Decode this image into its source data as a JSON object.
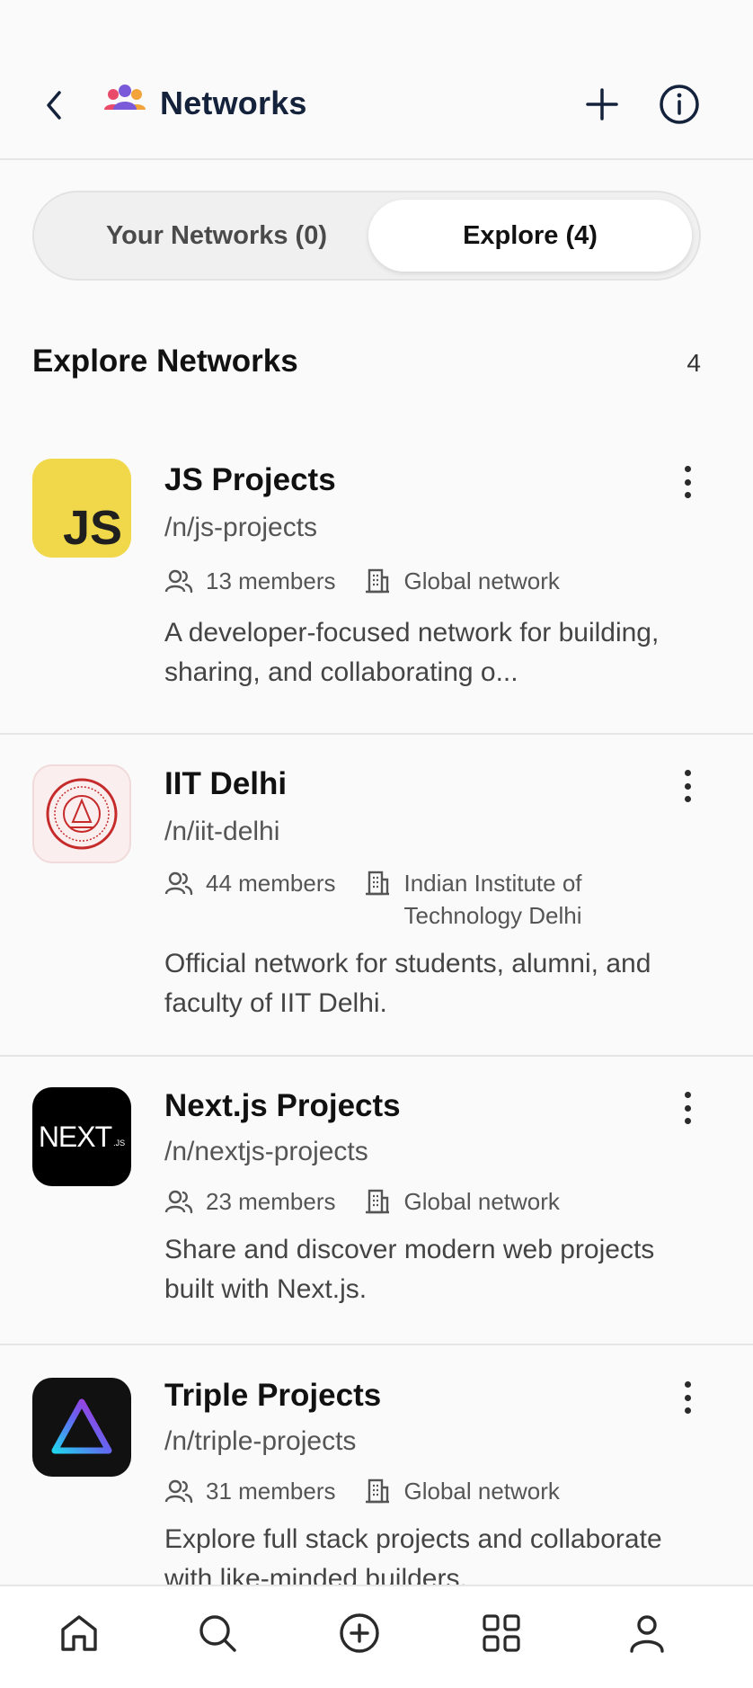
{
  "header": {
    "title": "Networks"
  },
  "tabs": [
    {
      "label": "Your Networks (0)",
      "active": false
    },
    {
      "label": "Explore (4)",
      "active": true
    }
  ],
  "section": {
    "title": "Explore Networks",
    "count": "4"
  },
  "networks": [
    {
      "name": "JS Projects",
      "slug": "/n/js-projects",
      "members": "13 members",
      "scope": "Global network",
      "description": "A developer-focused network for building, sharing, and collaborating o...",
      "logo_text": "JS",
      "logo_color": "#f0d84a"
    },
    {
      "name": "IIT Delhi",
      "slug": "/n/iit-delhi",
      "members": "44 members",
      "scope": "Indian Institute of Technology Delhi",
      "description": "Official network for students, alumni, and faculty of IIT Delhi.",
      "logo_color": "#c62b2b"
    },
    {
      "name": "Next.js Projects",
      "slug": "/n/nextjs-projects",
      "members": "23 members",
      "scope": "Global network",
      "description": "Share and discover modern web projects built with Next.js.",
      "logo_text": "NEXT",
      "logo_subtext": ".JS",
      "logo_color": "#000000"
    },
    {
      "name": "Triple Projects",
      "slug": "/n/triple-projects",
      "members": "31 members",
      "scope": "Global network",
      "description": "Explore full stack projects and collaborate with like-minded builders.",
      "logo_color": "#111111"
    }
  ],
  "bottom_nav": [
    "home-icon",
    "search-icon",
    "create-icon",
    "apps-grid-icon",
    "profile-icon"
  ]
}
